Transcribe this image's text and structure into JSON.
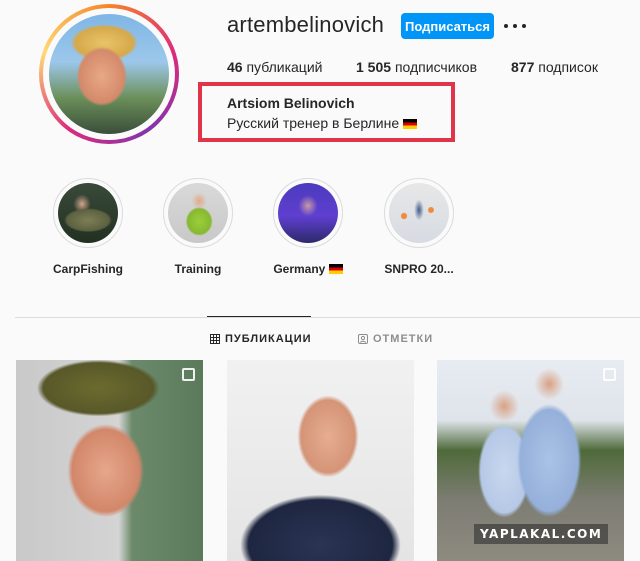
{
  "profile": {
    "username": "artembelinovich",
    "follow_label": "Подписаться",
    "more_icon": "ellipsis-horizontal-icon",
    "full_name": "Artsiom Belinovich",
    "bio": "Русский тренер в Берлине",
    "bio_flag": "german-flag-icon",
    "stats": {
      "posts_count": "46",
      "posts_label": "публикаций",
      "followers_count": "1 505",
      "followers_label": "подписчиков",
      "following_count": "877",
      "following_label": "подписок"
    },
    "highlight_color": "#e0344a"
  },
  "highlights": [
    {
      "label": "CarpFishing"
    },
    {
      "label": "Training"
    },
    {
      "label": "Germany"
    },
    {
      "label": "SNPRO 20..."
    }
  ],
  "tabs": {
    "posts": "ПУБЛИКАЦИИ",
    "tagged": "ОТМЕТКИ"
  },
  "watermark": "YAPLAKAL.COM",
  "colors": {
    "accent": "#0095f6",
    "text": "#262626",
    "muted": "#8e8e8e",
    "background": "#fafafa",
    "border": "#dbdbdb"
  }
}
